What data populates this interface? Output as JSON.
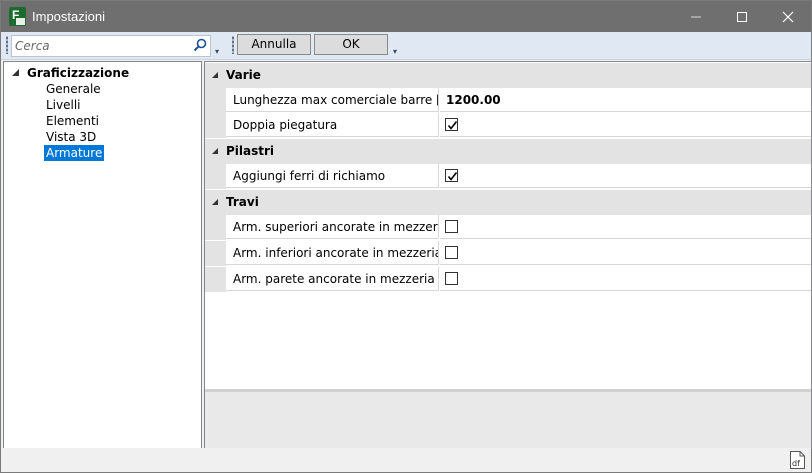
{
  "window": {
    "title": "Impostazioni",
    "app_icon_letter": "F"
  },
  "toolbar": {
    "search_placeholder": "Cerca",
    "cancel_label": "Annulla",
    "ok_label": "OK"
  },
  "tree": {
    "root": "Graficizzazione",
    "items": [
      {
        "label": "Generale"
      },
      {
        "label": "Livelli"
      },
      {
        "label": "Elementi"
      },
      {
        "label": "Vista 3D"
      },
      {
        "label": "Armature",
        "selected": true
      }
    ]
  },
  "grid": {
    "categories": [
      {
        "name": "Varie",
        "rows": [
          {
            "label": "Lunghezza max comerciale barre [cm]",
            "value": "1200.00"
          },
          {
            "label": "Doppia piegatura",
            "checked": true
          }
        ]
      },
      {
        "name": "Pilastri",
        "rows": [
          {
            "label": "Aggiungi ferri di richiamo",
            "checked": true
          }
        ]
      },
      {
        "name": "Travi",
        "rows": [
          {
            "label": "Arm. superiori ancorate in mezzeria",
            "checked": false
          },
          {
            "label": "Arm. inferiori ancorate in mezzeria",
            "checked": false
          },
          {
            "label": "Arm. parete ancorate in mezzeria",
            "checked": false
          }
        ]
      }
    ]
  },
  "status": {
    "icon": "df-file-icon",
    "icon_text": "df"
  }
}
